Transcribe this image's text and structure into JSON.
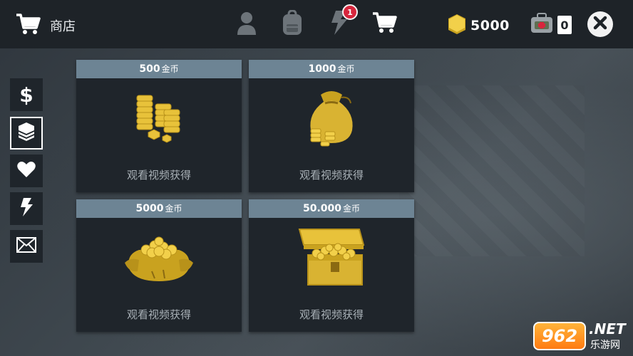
{
  "header": {
    "title": "商店",
    "notification_count": "1",
    "coin_balance": "5000",
    "kit_count": "0"
  },
  "icons": {
    "cart": "shopping-cart-icon",
    "profile": "person-icon",
    "backpack": "backpack-icon",
    "energy": "lightning-icon",
    "coin": "coin-icon",
    "kit": "medkit-icon",
    "close": "close-icon"
  },
  "side_tabs": [
    {
      "id": "cash",
      "icon": "dollar-icon",
      "glyph": "$",
      "active": false
    },
    {
      "id": "coins",
      "icon": "coin-stack-icon",
      "active": true
    },
    {
      "id": "favorites",
      "icon": "heart-icon",
      "active": false
    },
    {
      "id": "energy",
      "icon": "lightning-icon",
      "active": false
    },
    {
      "id": "mail",
      "icon": "mail-icon",
      "active": false
    }
  ],
  "offers": [
    {
      "amount": "500",
      "unit": "金币",
      "action": "观看视频获得",
      "art": "coin-stacks"
    },
    {
      "amount": "1000",
      "unit": "金币",
      "action": "观看视频获得",
      "art": "coin-sack"
    },
    {
      "amount": "5000",
      "unit": "金币",
      "action": "观看视频获得",
      "art": "open-coin-bag"
    },
    {
      "amount": "50.000",
      "unit": "金币",
      "action": "观看视频获得",
      "art": "treasure-chest"
    }
  ],
  "watermark": {
    "number": "962",
    "domain": ".NET",
    "subtitle": "乐游网"
  },
  "colors": {
    "topbar": "#1e2328",
    "card_header": "#6d8494",
    "card_body": "#1f252b",
    "gold": "#e8c23a",
    "badge": "#d7263d"
  }
}
